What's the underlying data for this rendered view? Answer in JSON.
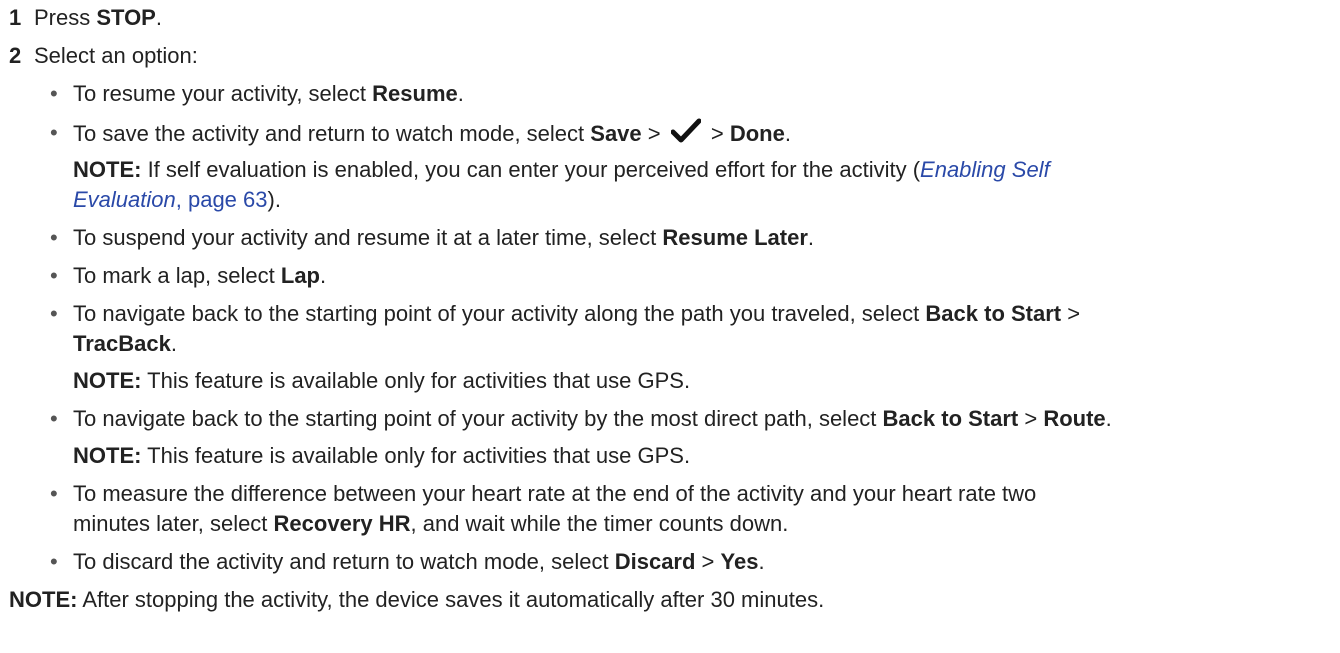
{
  "steps": [
    {
      "number": "1",
      "prefix": "Press ",
      "bold": "STOP",
      "suffix": "."
    },
    {
      "number": "2",
      "text": "Select an option:"
    }
  ],
  "options": {
    "resume": {
      "text": "To resume your activity, select ",
      "bold": "Resume",
      "suffix": "."
    },
    "save": {
      "text": "To save the activity and return to watch mode, select ",
      "bold1": "Save",
      "sep1": " > ",
      "sep2": " > ",
      "bold2": "Done",
      "suffix": ".",
      "check_icon": "checkmark-icon",
      "note_label": "NOTE:",
      "note_text": " If self evaluation is enabled, you can enter your perceived effort for the activity (",
      "note_link_italic_1": "Enabling Self",
      "note_link_italic_2": "Evaluation",
      "note_link_page": ", page 63",
      "note_close": ")."
    },
    "resume_later": {
      "text": "To suspend your activity and resume it at a later time, select ",
      "bold": "Resume Later",
      "suffix": "."
    },
    "lap": {
      "text": "To mark a lap, select ",
      "bold": "Lap",
      "suffix": "."
    },
    "tracback": {
      "text": "To navigate back to the starting point of your activity along the path you traveled, select ",
      "bold1": "Back to Start",
      "sep": " >",
      "bold2": "TracBack",
      "suffix": ".",
      "note_label": "NOTE:",
      "note_text": " This feature is available only for activities that use GPS."
    },
    "route": {
      "text": "To navigate back to the starting point of your activity by the most direct path, select ",
      "bold1": "Back to Start",
      "sep": " > ",
      "bold2": "Route",
      "suffix": ".",
      "note_label": "NOTE:",
      "note_text": " This feature is available only for activities that use GPS."
    },
    "recovery": {
      "text1": "To measure the difference between your heart rate at the end of the activity and your heart rate two",
      "text2": "minutes later, select ",
      "bold": "Recovery HR",
      "suffix": ", and wait while the timer counts down."
    },
    "discard": {
      "text": "To discard the activity and return to watch mode, select ",
      "bold1": "Discard",
      "sep": " > ",
      "bold2": "Yes",
      "suffix": "."
    }
  },
  "bullet_char": "•",
  "final_note": {
    "label": "NOTE:",
    "text": " After stopping the activity, the device saves it automatically after 30 minutes."
  },
  "colors": {
    "text": "#222222",
    "link": "#2a49a8"
  }
}
